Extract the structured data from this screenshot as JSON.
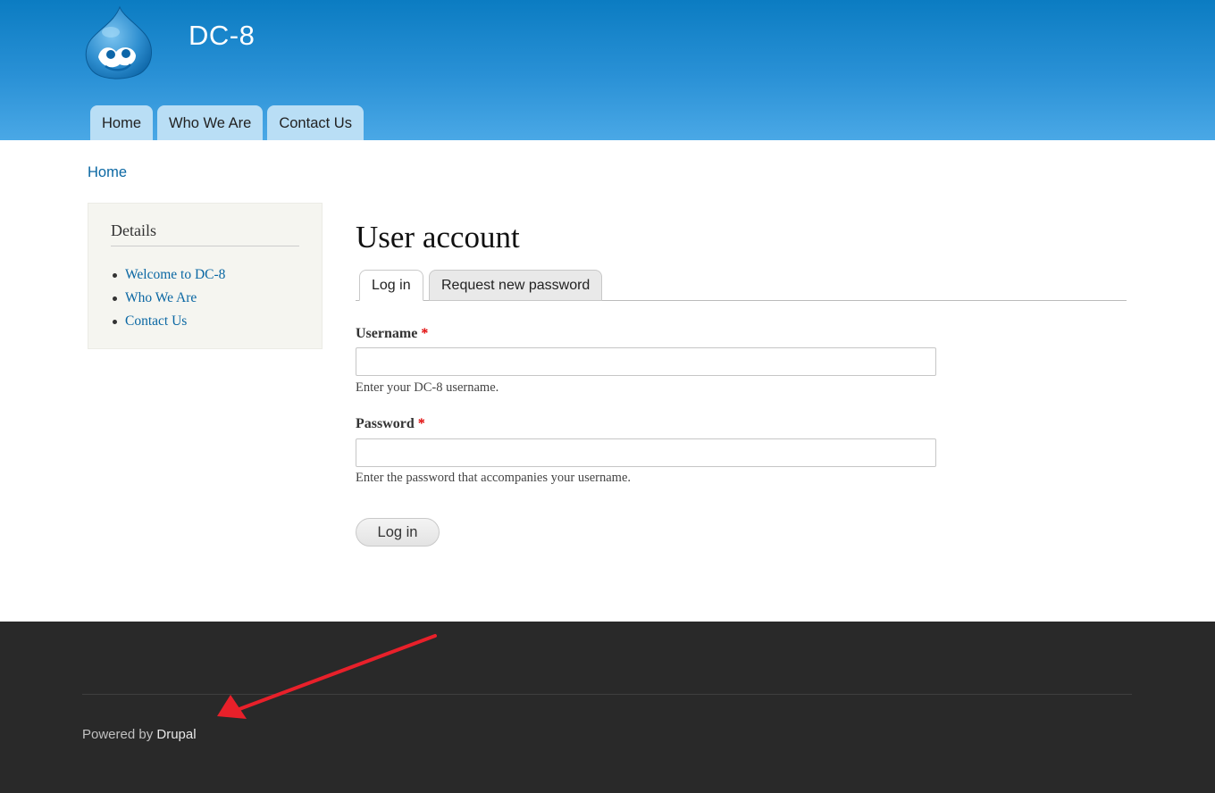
{
  "header": {
    "site_name": "DC-8",
    "logo_icon": "drupal-drop-logo",
    "nav": [
      {
        "label": "Home"
      },
      {
        "label": "Who We Are"
      },
      {
        "label": "Contact Us"
      }
    ]
  },
  "breadcrumb": {
    "home": "Home"
  },
  "sidebar": {
    "title": "Details",
    "items": [
      {
        "label": "Welcome to DC-8"
      },
      {
        "label": "Who We Are"
      },
      {
        "label": "Contact Us"
      }
    ]
  },
  "main": {
    "title": "User account",
    "tabs": [
      {
        "label": "Log in",
        "active": true
      },
      {
        "label": "Request new password",
        "active": false
      }
    ],
    "form": {
      "username_label": "Username",
      "username_required": "*",
      "username_value": "",
      "username_desc": "Enter your DC-8 username.",
      "password_label": "Password",
      "password_required": "*",
      "password_value": "",
      "password_desc": "Enter the password that accompanies your username.",
      "submit_label": "Log in"
    }
  },
  "footer": {
    "powered_prefix": "Powered by",
    "powered_link": "Drupal"
  },
  "colors": {
    "header_top": "#0b7cc2",
    "header_bottom": "#4aa8e6",
    "link": "#0a67a3",
    "footer_bg": "#292929",
    "required": "#e00000",
    "annotation_arrow": "#e8202a"
  }
}
